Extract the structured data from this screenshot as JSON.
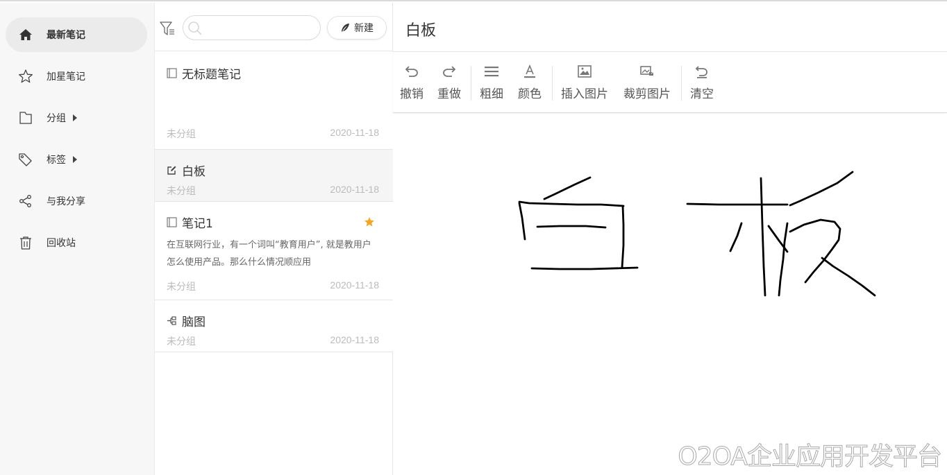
{
  "sidebar": {
    "items": [
      {
        "label": "最新笔记",
        "icon": "home-icon",
        "active": true
      },
      {
        "label": "加星笔记",
        "icon": "star-icon"
      },
      {
        "label": "分组",
        "icon": "folder-icon",
        "has_submenu": true
      },
      {
        "label": "标签",
        "icon": "tag-icon",
        "has_submenu": true
      },
      {
        "label": "与我分享",
        "icon": "share-icon"
      },
      {
        "label": "回收站",
        "icon": "trash-icon"
      }
    ]
  },
  "list": {
    "search_placeholder": "",
    "new_label": "新建",
    "notes": [
      {
        "title": "无标题笔记",
        "icon": "note-icon",
        "preview": "",
        "group": "未分组",
        "date": "2020-11-18"
      },
      {
        "title": "白板",
        "icon": "edit-icon",
        "preview": "",
        "group": "未分组",
        "date": "2020-11-18",
        "active": true
      },
      {
        "title": "笔记1",
        "icon": "note-icon",
        "preview": "在互联网行业，有一个词叫“教育用户”, 就是教用户怎么使用产品。那么什么情况顺应用",
        "group": "未分组",
        "date": "2020-11-18",
        "starred": true
      },
      {
        "title": "脑图",
        "icon": "mindmap-icon",
        "preview": "",
        "group": "未分组",
        "date": "2020-11-18"
      }
    ]
  },
  "editor": {
    "title": "白板",
    "toolbar": {
      "undo": "撤销",
      "redo": "重做",
      "thickness": "粗细",
      "color": "颜色",
      "insert_image": "插入图片",
      "crop_image": "裁剪图片",
      "clear": "清空"
    }
  },
  "watermark": "O2OA企业应用开发平台",
  "colors": {
    "star": "#f5a623",
    "active_bg": "#ebebeb",
    "ink": "#000000"
  }
}
